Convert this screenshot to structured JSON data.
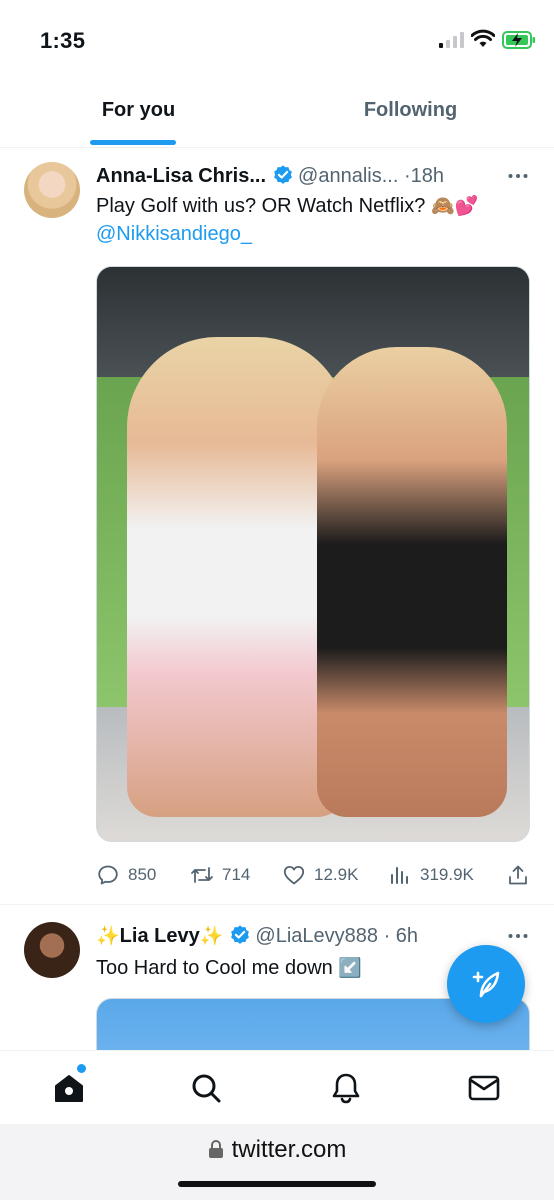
{
  "status_bar": {
    "time": "1:35"
  },
  "tabs": [
    {
      "label": "For you",
      "active": true
    },
    {
      "label": "Following",
      "active": false
    }
  ],
  "tweets": [
    {
      "name": "Anna-Lisa Chris...",
      "handle": "@annalis...",
      "separator": "·",
      "age": "18h",
      "text": "Play Golf with us? OR Watch Netflix?",
      "emojis": "🙈💕",
      "mention": "@Nikkisandiego_",
      "actions": {
        "replies": "850",
        "retweets": "714",
        "likes": "12.9K",
        "views": "319.9K"
      }
    },
    {
      "name_prefix": "✨",
      "name": "Lia Levy",
      "name_suffix": "✨",
      "handle": "@LiaLevy888",
      "separator": "·",
      "age": "6h",
      "text": "Too Hard to Cool me down",
      "emojis": "↙️"
    }
  ],
  "browser": {
    "url": "twitter.com"
  },
  "colors": {
    "accent": "#1d9bf0",
    "text": "#0f1419",
    "muted": "#536471"
  },
  "icons": [
    "verified-badge-icon",
    "more-icon",
    "reply-icon",
    "retweet-icon",
    "like-icon",
    "views-icon",
    "share-icon",
    "compose-icon",
    "home-icon",
    "search-icon",
    "notifications-icon",
    "messages-icon",
    "lock-icon"
  ]
}
